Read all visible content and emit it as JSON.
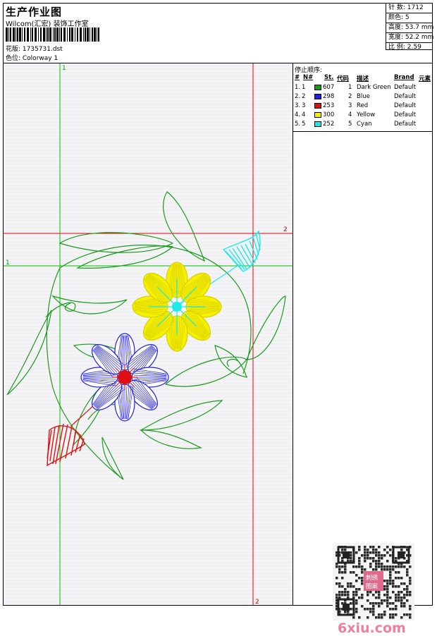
{
  "header": {
    "title": "生产作业图",
    "company": "Wilcom(汇宏) 装饰工作室",
    "design_file": "花版: 1735731.dst",
    "colorway": "色位: Colorway 1"
  },
  "stats": [
    {
      "label": "针 数:",
      "value": "1712"
    },
    {
      "label": "颜色:",
      "value": "5"
    },
    {
      "label": "高度:",
      "value": "53.7 mm"
    },
    {
      "label": "宽度:",
      "value": "52.2 mm"
    },
    {
      "label": "比 例:",
      "value": "2.59"
    }
  ],
  "guides": {
    "marker_1": "1",
    "marker_2": "2"
  },
  "stop_sequence": {
    "title": "停止顺序:",
    "headers": [
      "#",
      "N#",
      "St.",
      "代码",
      "描述",
      "Brand",
      "元素"
    ],
    "rows": [
      {
        "idx": "1.",
        "n": "1",
        "color": "#1a9a1a",
        "st": "607",
        "code": "1",
        "desc": "Dark Green",
        "brand": "Default"
      },
      {
        "idx": "2.",
        "n": "2",
        "color": "#2020e0",
        "st": "298",
        "code": "2",
        "desc": "Blue",
        "brand": "Default"
      },
      {
        "idx": "3.",
        "n": "3",
        "color": "#e01010",
        "st": "253",
        "code": "3",
        "desc": "Red",
        "brand": "Default"
      },
      {
        "idx": "4.",
        "n": "4",
        "color": "#f5f000",
        "st": "300",
        "code": "4",
        "desc": "Yellow",
        "brand": "Default"
      },
      {
        "idx": "5.",
        "n": "5",
        "color": "#20e8e8",
        "st": "252",
        "code": "5",
        "desc": "Cyan",
        "brand": "Default"
      }
    ]
  },
  "watermark": {
    "site": "6xiu.com",
    "qr_badge": "刺绣图案"
  },
  "colors": {
    "guide_green": "#00c000",
    "guide_red": "#e00000",
    "stitch_green": "#1a9a1a",
    "stitch_blue": "#2020e0",
    "stitch_red": "#e01010",
    "stitch_yellow": "#f5f000",
    "stitch_cyan": "#20e8e8"
  }
}
